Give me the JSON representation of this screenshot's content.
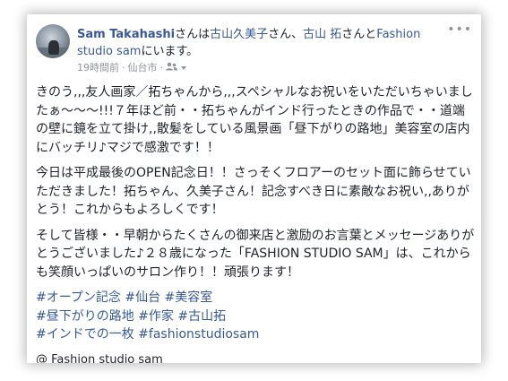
{
  "post": {
    "author": "Sam Takahashi",
    "tag_text_1": "さんは",
    "tagged_1": "古山久美子",
    "tag_text_2": "さん、",
    "tagged_2": "古山 拓",
    "tag_text_3": "さんと",
    "place": "Fashion studio sam",
    "tag_text_4": "にいます。",
    "time": "19時間前",
    "location_meta": "仙台市",
    "audience_icon": "friends-icon",
    "more_icon": "more-options-icon",
    "more_label": "•••",
    "paragraphs": [
      "きのう,,,友人画家／拓ちゃんから,,,スペシャルなお祝いをいただいちゃいましたぁ〜〜〜!!!７年ほど前・・拓ちゃんがインド行ったときの作品で・・道端の壁に鏡を立て掛け,,散髪をしている風景画「昼下がりの路地」美容室の店内にバッチリ♪マジで感激です！！",
      "今日は平成最後のOPEN記念日！！さっそくフロアーのセット面に飾らせていただきました！拓ちゃん、久美子さん！記念すべき日に素敵なお祝い,,ありがとう！これからもよろしくです！",
      "そして皆様・・早朝からたくさんの御来店と激励のお言葉とメッセージありがとうございました♪２８歳になった「FASHION STUDIO SAM」は、これからも笑顔いっぱいのサロン作り！！頑張ります！"
    ],
    "hashtag_lines": [
      "#オープン記念 #仙台 #美容室",
      "#昼下がりの路地 #作家 #古山拓",
      "#インドでの一枚 #fashionstudiosam"
    ],
    "location_line": "@ Fashion studio sam"
  }
}
